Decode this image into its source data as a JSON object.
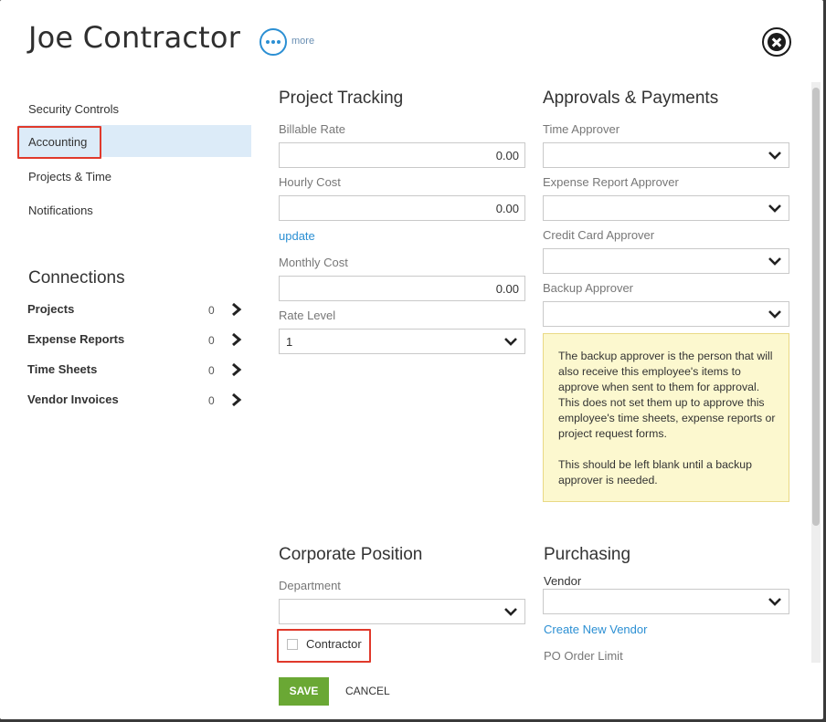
{
  "header": {
    "title": "Joe Contractor",
    "more_label": "more"
  },
  "sidebar": {
    "items": [
      {
        "label": "Security Controls"
      },
      {
        "label": "Accounting"
      },
      {
        "label": "Projects & Time"
      },
      {
        "label": "Notifications"
      }
    ],
    "connections_title": "Connections",
    "connections": [
      {
        "label": "Projects",
        "count": "0"
      },
      {
        "label": "Expense Reports",
        "count": "0"
      },
      {
        "label": "Time Sheets",
        "count": "0"
      },
      {
        "label": "Vendor Invoices",
        "count": "0"
      }
    ]
  },
  "project_tracking": {
    "title": "Project Tracking",
    "billable_rate_label": "Billable Rate",
    "billable_rate_value": "0.00",
    "hourly_cost_label": "Hourly Cost",
    "hourly_cost_value": "0.00",
    "update_link": "update",
    "monthly_cost_label": "Monthly Cost",
    "monthly_cost_value": "0.00",
    "rate_level_label": "Rate Level",
    "rate_level_value": "1"
  },
  "approvals": {
    "title": "Approvals & Payments",
    "time_approver_label": "Time Approver",
    "expense_report_approver_label": "Expense Report Approver",
    "credit_card_approver_label": "Credit Card Approver",
    "backup_approver_label": "Backup Approver",
    "note_p1": "The backup approver is the person that will also receive this employee's items to approve when sent to them for approval. This does not set them up to approve this employee's time sheets, expense reports or project request forms.",
    "note_p2": "This should be left blank until a backup approver is needed."
  },
  "corporate_position": {
    "title": "Corporate Position",
    "department_label": "Department",
    "contractor_label": "Contractor"
  },
  "purchasing": {
    "title": "Purchasing",
    "vendor_label": "Vendor",
    "create_vendor_link": "Create New Vendor",
    "po_order_limit_label": "PO Order Limit"
  },
  "footer": {
    "save_label": "SAVE",
    "cancel_label": "CANCEL"
  },
  "icons": {
    "more": "more-dots-icon",
    "close": "close-circle-icon",
    "chevron": "chevron-down-icon",
    "chevron_right": "chevron-right-icon"
  },
  "colors": {
    "accent": "#2b8fd3",
    "save": "#6aa834",
    "highlight": "#e0392b",
    "note_bg": "#fcf8cf",
    "active_item": "#dcebf8"
  }
}
